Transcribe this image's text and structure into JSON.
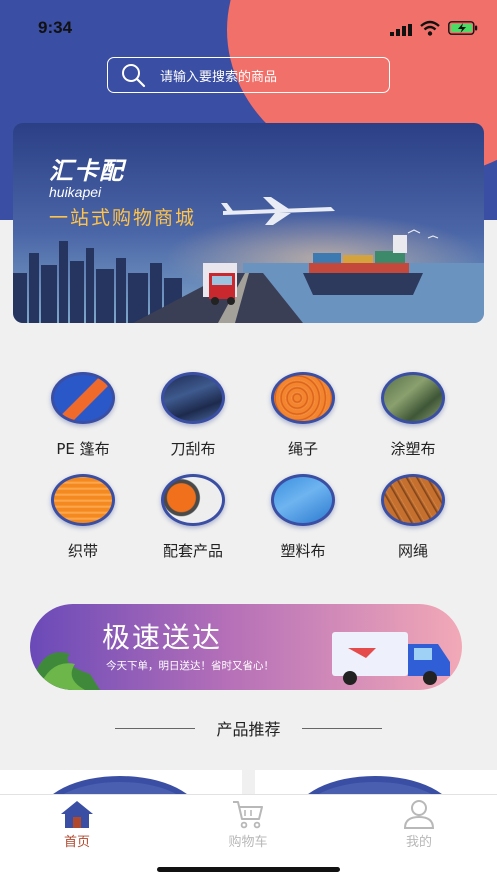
{
  "status": {
    "time": "9:34"
  },
  "search": {
    "placeholder": "请输入要搜索的商品"
  },
  "banner": {
    "brand_cn": "汇卡配",
    "brand_en": "huikapei",
    "slogan": "一站式购物商城"
  },
  "categories": [
    {
      "label": "PE 篷布",
      "icon": "tarp-icon"
    },
    {
      "label": "刀刮布",
      "icon": "knife-coated-fabric-icon"
    },
    {
      "label": "绳子",
      "icon": "rope-icon"
    },
    {
      "label": "涂塑布",
      "icon": "coated-fabric-icon"
    },
    {
      "label": "织带",
      "icon": "webbing-icon"
    },
    {
      "label": "配套产品",
      "icon": "accessories-icon"
    },
    {
      "label": "塑料布",
      "icon": "plastic-sheet-icon"
    },
    {
      "label": "网绳",
      "icon": "net-rope-icon"
    }
  ],
  "promo": {
    "title": "极速送达",
    "subtitle": "今天下单，明日送达！省时又省心！"
  },
  "recommend": {
    "title": "产品推荐"
  },
  "tabs": [
    {
      "label": "首页",
      "active": true,
      "color": "#b0482e"
    },
    {
      "label": "购物车",
      "active": false,
      "color": "#b8b8b8"
    },
    {
      "label": "我的",
      "active": false,
      "color": "#b8b8b8"
    }
  ],
  "colors": {
    "brand_blue": "#3a4ea3",
    "accent_coral": "#f2706a",
    "slogan_gold": "#ffc34a"
  }
}
